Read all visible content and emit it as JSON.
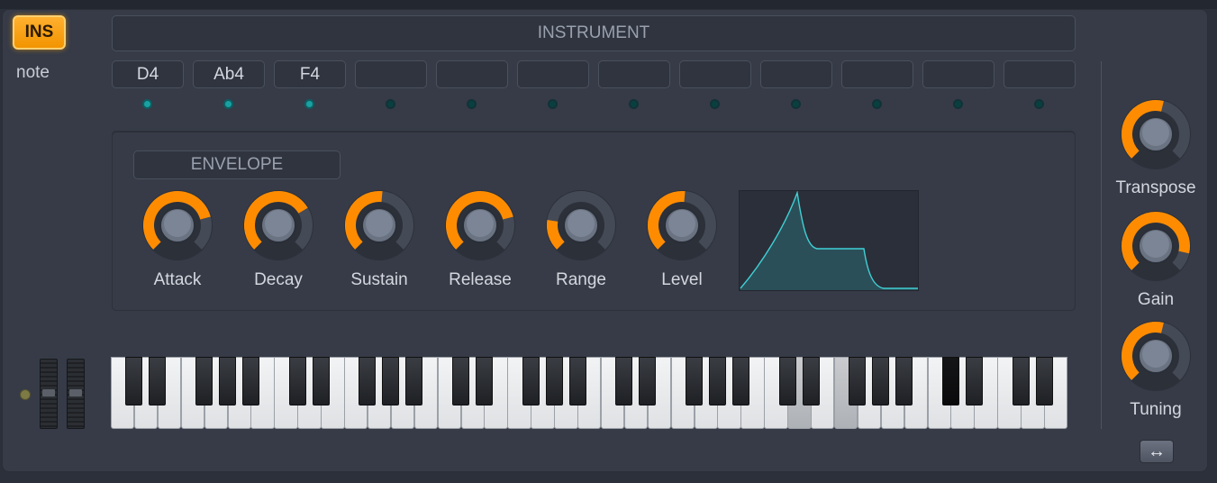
{
  "header": {
    "ins_label": "INS",
    "title": "INSTRUMENT"
  },
  "note_label": "note",
  "note_slots": [
    {
      "value": "D4",
      "active": true
    },
    {
      "value": "Ab4",
      "active": true
    },
    {
      "value": "F4",
      "active": true
    },
    {
      "value": "",
      "active": false
    },
    {
      "value": "",
      "active": false
    },
    {
      "value": "",
      "active": false
    },
    {
      "value": "",
      "active": false
    },
    {
      "value": "",
      "active": false
    },
    {
      "value": "",
      "active": false
    },
    {
      "value": "",
      "active": false
    },
    {
      "value": "",
      "active": false
    },
    {
      "value": "",
      "active": false
    }
  ],
  "envelope": {
    "title": "ENVELOPE",
    "knobs": [
      {
        "label": "Attack",
        "value": 0.78
      },
      {
        "label": "Decay",
        "value": 0.72
      },
      {
        "label": "Sustain",
        "value": 0.52
      },
      {
        "label": "Release",
        "value": 0.78
      },
      {
        "label": "Range",
        "value": 0.2
      },
      {
        "label": "Level",
        "value": 0.52
      }
    ]
  },
  "side_knobs": [
    {
      "label": "Transpose",
      "value": 0.55
    },
    {
      "label": "Gain",
      "value": 0.88
    },
    {
      "label": "Tuning",
      "value": 0.55
    }
  ],
  "keyboard": {
    "pressed_white": [
      29,
      31
    ],
    "pressed_black": [
      25
    ]
  },
  "colors": {
    "accent": "#ff8c00",
    "led_on": "#1aa0a0",
    "led_off": "#0a3f3f",
    "graph_line": "#3fd0d6"
  },
  "icons": {
    "swap": "left-right-arrow-icon"
  }
}
